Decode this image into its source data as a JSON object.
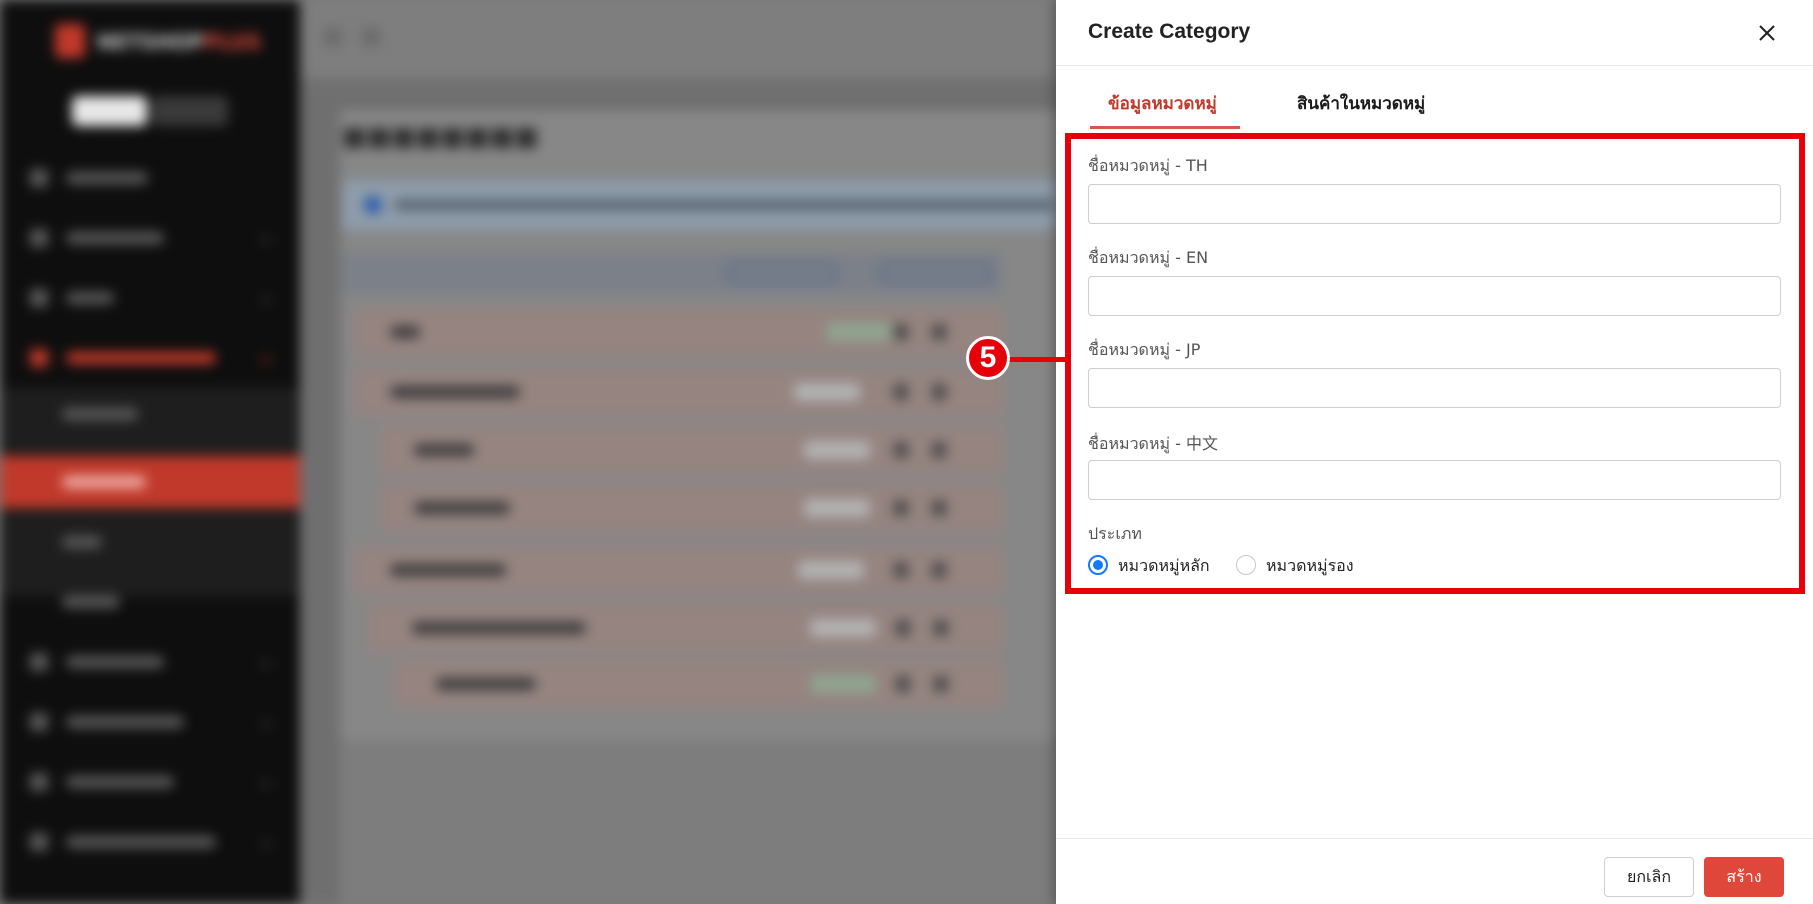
{
  "app": {
    "logo_text_main": "NETSHOP",
    "logo_text_accent": "PLUS"
  },
  "drawer": {
    "title": "Create Category",
    "tabs": [
      {
        "label": "ข้อมูลหมวดหมู่",
        "active": true
      },
      {
        "label": "สินค้าในหมวดหมู่",
        "active": false
      }
    ],
    "fields": [
      {
        "label": "ชื่อหมวดหมู่ - TH",
        "value": "",
        "placeholder": ""
      },
      {
        "label": "ชื่อหมวดหมู่ - EN",
        "value": "",
        "placeholder": ""
      },
      {
        "label": "ชื่อหมวดหมู่ - JP",
        "value": "",
        "placeholder": ""
      },
      {
        "label": "ชื่อหมวดหมู่ - 中文",
        "value": "",
        "placeholder": ""
      }
    ],
    "type_label": "ประเภท",
    "type_options": [
      {
        "label": "หมวดหมู่หลัก",
        "checked": true
      },
      {
        "label": "หมวดหมู่รอง",
        "checked": false
      }
    ],
    "footer": {
      "cancel_label": "ยกเลิก",
      "create_label": "สร้าง"
    }
  },
  "annotation": {
    "step_number": "5",
    "color": "#e6000a"
  },
  "colors": {
    "accent": "#c0392b",
    "primary_button": "#e0473b",
    "radio_checked": "#1677ff"
  },
  "icons": {
    "close": "close-icon",
    "radio_checked": "radio-checked-icon",
    "radio_unchecked": "radio-unchecked-icon"
  }
}
